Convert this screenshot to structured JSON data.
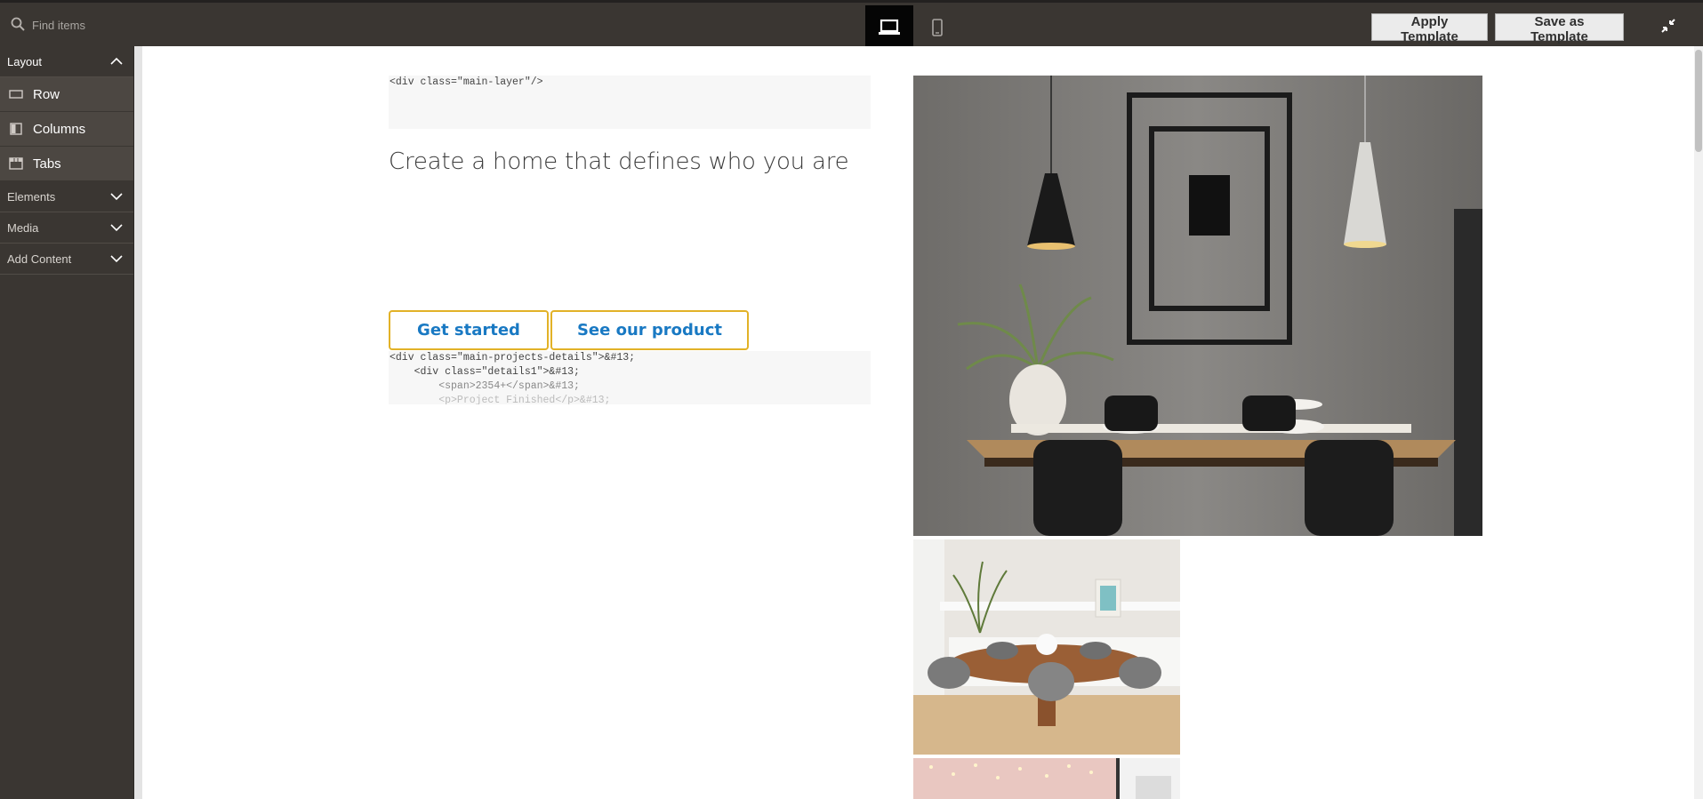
{
  "search": {
    "placeholder": "Find items",
    "icon": "search-icon"
  },
  "toolbar": {
    "device_desktop_icon": "laptop-icon",
    "device_mobile_icon": "mobile-icon",
    "apply_template": "Apply Template",
    "save_as_template": "Save as Template",
    "fullscreen_icon": "collapse-icon"
  },
  "sidebar": {
    "layout_label": "Layout",
    "items": [
      {
        "label": "Row",
        "icon": "row-icon"
      },
      {
        "label": "Columns",
        "icon": "columns-icon"
      },
      {
        "label": "Tabs",
        "icon": "tabs-icon"
      }
    ],
    "sections": [
      {
        "label": "Elements"
      },
      {
        "label": "Media"
      },
      {
        "label": "Add Content"
      }
    ]
  },
  "content": {
    "code_block_1": "<div class=\"main-layer\"/>",
    "headline": "Create a home that defines who you are",
    "buttons": {
      "primary": "Get started",
      "secondary": "See our product"
    },
    "code_block_2": {
      "line1": "<div class=\"main-projects-details\">&#13;",
      "line2": "    <div class=\"details1\">&#13;",
      "line3": "        <span>2354+</span>&#13;",
      "line4": "        <p>Project Finished</p>&#13;"
    }
  },
  "colors": {
    "accent_border": "#e2b227",
    "link_blue": "#1979c3",
    "panel_dark": "#3a3632"
  }
}
